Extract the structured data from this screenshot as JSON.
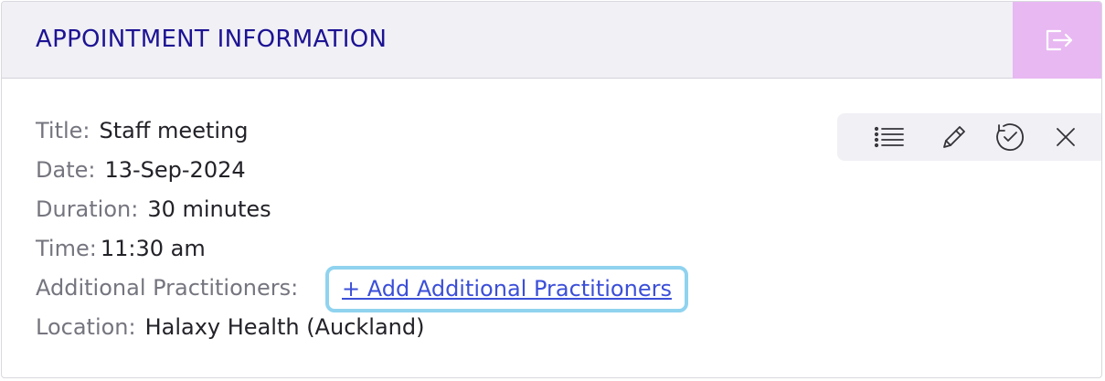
{
  "header": {
    "title": "APPOINTMENT INFORMATION",
    "exit_icon": "exit-icon"
  },
  "details": {
    "title_label": "Title:",
    "title_value": "Staff meeting",
    "date_label": "Date:",
    "date_value": "13-Sep-2024",
    "duration_label": "Duration:",
    "duration_value": "30 minutes",
    "time_label": "Time:",
    "time_value": "11:30 am",
    "practitioners_label": "Additional Practitioners:",
    "practitioners_link": "+ Add Additional Practitioners",
    "location_label": "Location:",
    "location_value": "Halaxy Health (Auckland)"
  },
  "toolbar": {
    "icons": [
      "list-icon",
      "pencil-icon",
      "clock-check-icon",
      "close-icon"
    ]
  },
  "colors": {
    "header_bg": "#f0f0f5",
    "title_color": "#1d1393",
    "exit_bg": "#e8b8f2",
    "link_color": "#3b4fd8",
    "highlight_border": "#8fd3ef"
  }
}
